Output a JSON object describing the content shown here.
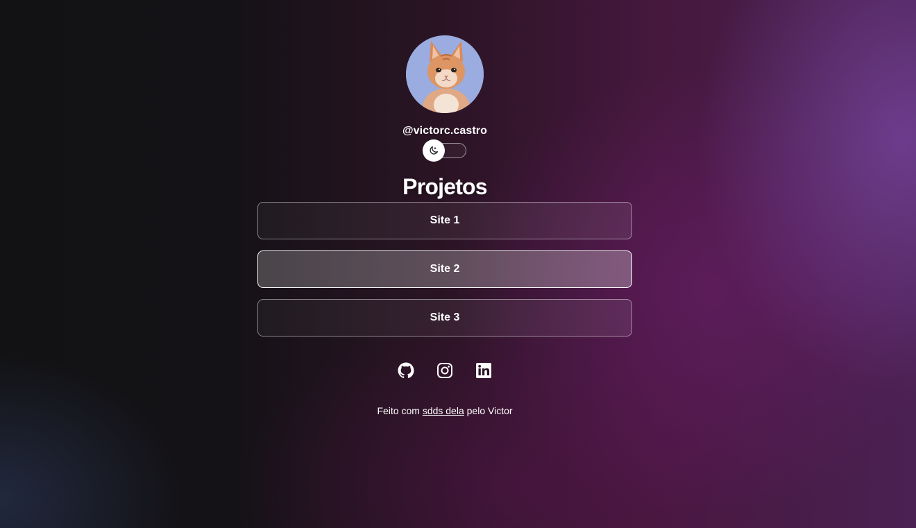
{
  "profile": {
    "username": "@victorc.castro"
  },
  "theme_toggle": {
    "state": "dark",
    "icon": "moon-icon"
  },
  "title": "Projetos",
  "links": [
    {
      "label": "Site 1"
    },
    {
      "label": "Site 2"
    },
    {
      "label": "Site 3"
    }
  ],
  "socials": [
    {
      "icon": "github-icon"
    },
    {
      "icon": "instagram-icon"
    },
    {
      "icon": "linkedin-icon"
    }
  ],
  "footer": {
    "prefix": "Feito com",
    "link_text": "sdds dela",
    "suffix": "pelo Victor"
  },
  "colors": {
    "text": "#ffffff",
    "background_left": "#121214",
    "background_right": "#4a2152"
  }
}
